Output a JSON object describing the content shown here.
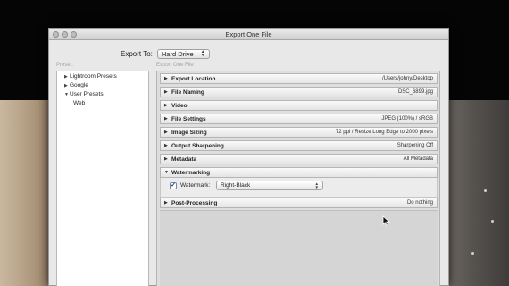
{
  "window": {
    "title": "Export One File"
  },
  "export_to": {
    "label": "Export To:",
    "value": "Hard Drive"
  },
  "presets": {
    "header": "Preset:",
    "items": [
      {
        "label": "Lightroom Presets",
        "expanded": false
      },
      {
        "label": "Google",
        "expanded": false
      },
      {
        "label": "User Presets",
        "expanded": true
      }
    ],
    "children": [
      {
        "label": "Web"
      }
    ]
  },
  "detail": {
    "header": "Export One File",
    "sections": [
      {
        "name": "Export Location",
        "summary": "/Users/johny/Desktop",
        "expanded": false
      },
      {
        "name": "File Naming",
        "summary": "DSC_6899.jpg",
        "expanded": false
      },
      {
        "name": "Video",
        "summary": "",
        "expanded": false
      },
      {
        "name": "File Settings",
        "summary": "JPEG (100%) / sRGB",
        "expanded": false
      },
      {
        "name": "Image Sizing",
        "summary": "72 ppi / Resize Long Edge to 2000 pixels",
        "expanded": false
      },
      {
        "name": "Output Sharpening",
        "summary": "Sharpening Off",
        "expanded": false
      },
      {
        "name": "Metadata",
        "summary": "All Metadata",
        "expanded": false
      },
      {
        "name": "Watermarking",
        "summary": "",
        "expanded": true
      },
      {
        "name": "Post-Processing",
        "summary": "Do nothing",
        "expanded": false
      }
    ],
    "watermark": {
      "checked": true,
      "label": "Watermark:",
      "value": "Right-Black"
    }
  },
  "icons": {
    "collapsed": "triangle-right-icon",
    "expanded": "triangle-down-icon",
    "checkmark": "checkmark-icon",
    "popup": "popup-arrows-icon",
    "cursor": "mouse-pointer-icon"
  }
}
